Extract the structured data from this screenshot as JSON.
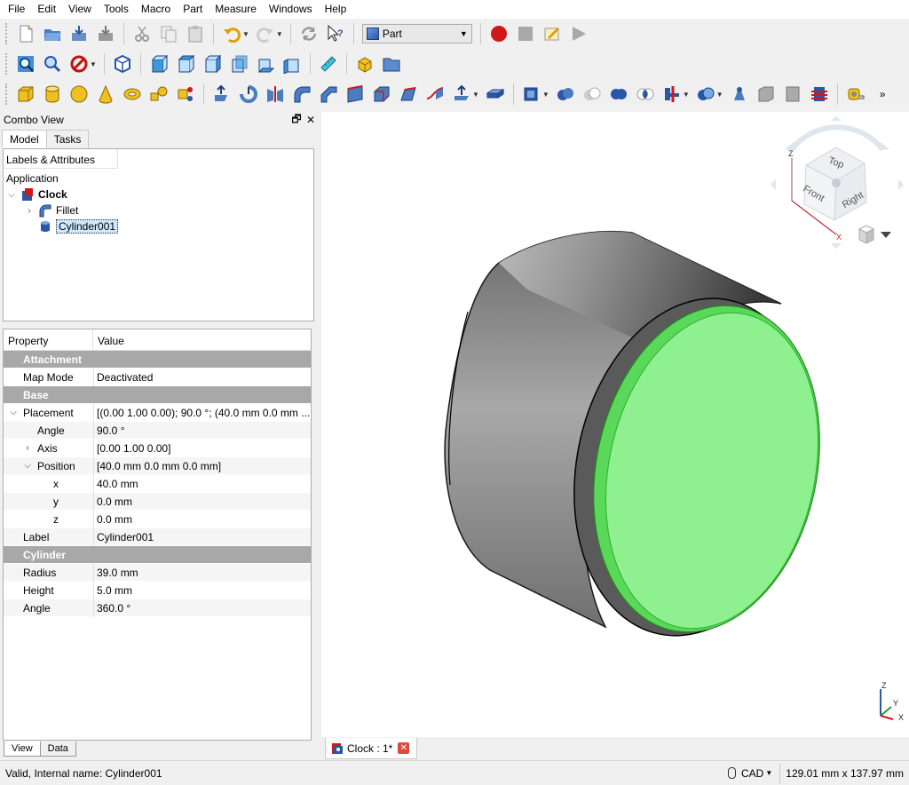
{
  "menubar": {
    "items": [
      "File",
      "Edit",
      "View",
      "Tools",
      "Macro",
      "Part",
      "Measure",
      "Windows",
      "Help"
    ]
  },
  "toolbar": {
    "workbench": "Part"
  },
  "combo_view": {
    "title": "Combo View",
    "tabs": [
      "Model",
      "Tasks"
    ],
    "active_tab": "Model",
    "tree": {
      "header": "Labels & Attributes",
      "application_label": "Application",
      "items": [
        {
          "label": "Clock",
          "level": 0,
          "expanded": true,
          "bold": true
        },
        {
          "label": "Fillet",
          "level": 1,
          "expanded": false,
          "bold": false
        },
        {
          "label": "Cylinder001",
          "level": 1,
          "selected": true,
          "bold": false
        }
      ]
    },
    "properties": {
      "col_property": "Property",
      "col_value": "Value",
      "rows": [
        {
          "type": "group",
          "name": "Attachment"
        },
        {
          "type": "prop",
          "name": "Map Mode",
          "value": "Deactivated",
          "indent": 1
        },
        {
          "type": "group",
          "name": "Base"
        },
        {
          "type": "prop",
          "name": "Placement",
          "value": "[(0.00 1.00 0.00); 90.0 °; (40.0 mm  0.0 mm  ...",
          "indent": 1,
          "expander": "open"
        },
        {
          "type": "prop",
          "name": "Angle",
          "value": "90.0 °",
          "indent": 2
        },
        {
          "type": "prop",
          "name": "Axis",
          "value": "[0.00 1.00 0.00]",
          "indent": 2,
          "expander": "closed"
        },
        {
          "type": "prop",
          "name": "Position",
          "value": "[40.0 mm  0.0 mm  0.0 mm]",
          "indent": 2,
          "expander": "open"
        },
        {
          "type": "prop",
          "name": "x",
          "value": "40.0 mm",
          "indent": 3
        },
        {
          "type": "prop",
          "name": "y",
          "value": "0.0 mm",
          "indent": 3
        },
        {
          "type": "prop",
          "name": "z",
          "value": "0.0 mm",
          "indent": 3
        },
        {
          "type": "prop",
          "name": "Label",
          "value": "Cylinder001",
          "indent": 1
        },
        {
          "type": "group",
          "name": "Cylinder"
        },
        {
          "type": "prop",
          "name": "Radius",
          "value": "39.0 mm",
          "indent": 1
        },
        {
          "type": "prop",
          "name": "Height",
          "value": "5.0 mm",
          "indent": 1
        },
        {
          "type": "prop",
          "name": "Angle",
          "value": "360.0 °",
          "indent": 1
        }
      ]
    },
    "bottom_tabs": [
      "View",
      "Data"
    ],
    "active_bottom_tab": "View"
  },
  "navcube": {
    "faces": [
      "Top",
      "Front",
      "Right"
    ]
  },
  "axes_labels": {
    "z": "Z",
    "y": "Y",
    "x": "X"
  },
  "document_tab": {
    "label": "Clock : 1*"
  },
  "statusbar": {
    "message": "Valid, Internal name: Cylinder001",
    "nav_style": "CAD",
    "dimensions": "129.01 mm x 137.97 mm"
  },
  "colors": {
    "selection_green": "#8ef08e",
    "cylinder_gray": "#8a8a8a",
    "group_header": "#a8a8a8"
  }
}
